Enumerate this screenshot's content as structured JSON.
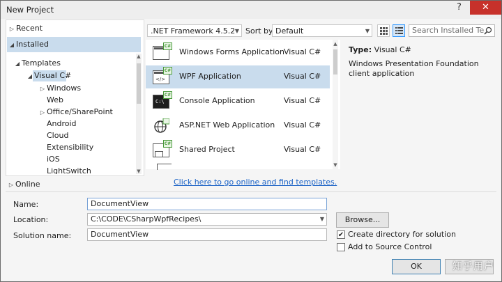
{
  "window": {
    "title": "New Project",
    "help_button": "?",
    "close_button": "✕"
  },
  "left_pane": {
    "recent": "Recent",
    "installed": "Installed",
    "templates": "Templates",
    "visual_csharp": "Visual C#",
    "children": [
      "Windows",
      "Web",
      "Office/SharePoint",
      "Android",
      "Cloud",
      "Extensibility",
      "iOS",
      "LightSwitch"
    ],
    "online": "Online"
  },
  "toolbar": {
    "framework": ".NET Framework 4.5.2",
    "sort_label": "Sort by:",
    "sort_value": "Default",
    "search_placeholder": "Search Installed Te",
    "search_icon": "magnifier-icon"
  },
  "templates": [
    {
      "name": "Windows Forms Application",
      "lang": "Visual C#",
      "selected": false
    },
    {
      "name": "WPF Application",
      "lang": "Visual C#",
      "selected": true
    },
    {
      "name": "Console Application",
      "lang": "Visual C#",
      "selected": false
    },
    {
      "name": "ASP.NET Web Application",
      "lang": "Visual C#",
      "selected": false
    },
    {
      "name": "Shared Project",
      "lang": "Visual C#",
      "selected": false
    }
  ],
  "online_link": "Click here to go online and find templates.",
  "details": {
    "type_label": "Type:",
    "type_value": "Visual C#",
    "description": "Windows Presentation Foundation client application"
  },
  "form": {
    "name_label": "Name:",
    "name_value": "DocumentView",
    "location_label": "Location:",
    "location_value": "C:\\CODE\\CSharpWpfRecipes\\",
    "browse_button": "Browse...",
    "solution_label": "Solution name:",
    "solution_value": "DocumentView",
    "create_dir_label": "Create directory for solution",
    "create_dir_checked": true,
    "source_control_label": "Add to Source Control",
    "source_control_checked": false,
    "ok_button": "OK"
  },
  "watermark": "知乎用户",
  "colors": {
    "selection": "#c9dced",
    "link": "#1a62c6",
    "close": "#c7312b"
  }
}
